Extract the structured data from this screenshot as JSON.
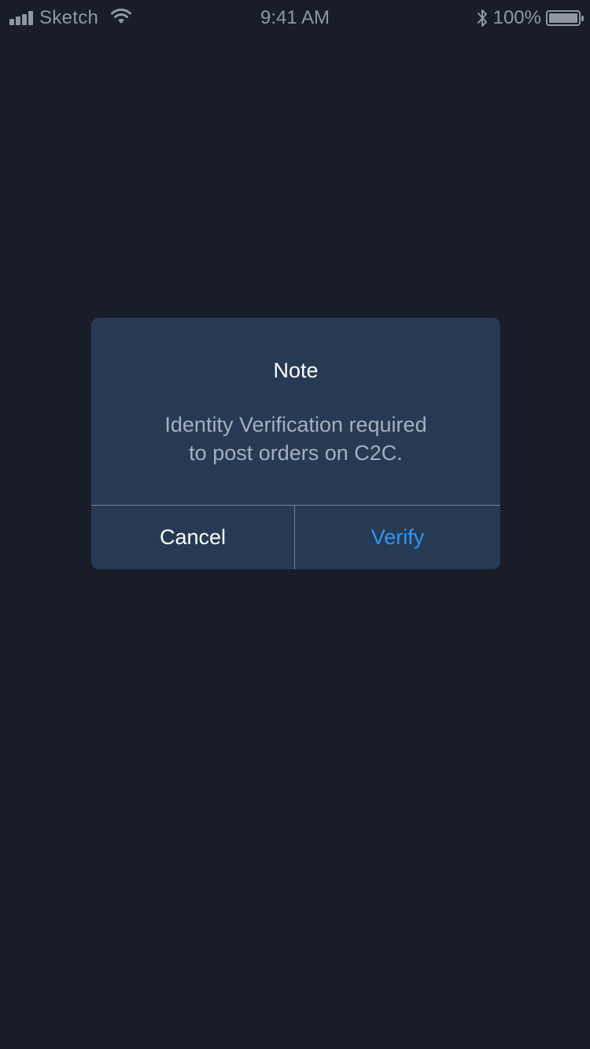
{
  "status_bar": {
    "carrier": "Sketch",
    "time": "9:41 AM",
    "battery_percent": "100%",
    "icons": [
      "signal-icon",
      "wifi-icon",
      "bluetooth-icon",
      "battery-icon"
    ],
    "battery_level": 1.0
  },
  "dialog": {
    "title": "Note",
    "message_line1": "Identity Verification required",
    "message_line2": "to post orders on C2C.",
    "cancel_label": "Cancel",
    "verify_label": "Verify"
  },
  "colors": {
    "background": "#181d28",
    "dialog_bg": "#273a54",
    "accent": "#2f95f2",
    "divider": "#6f8299"
  }
}
